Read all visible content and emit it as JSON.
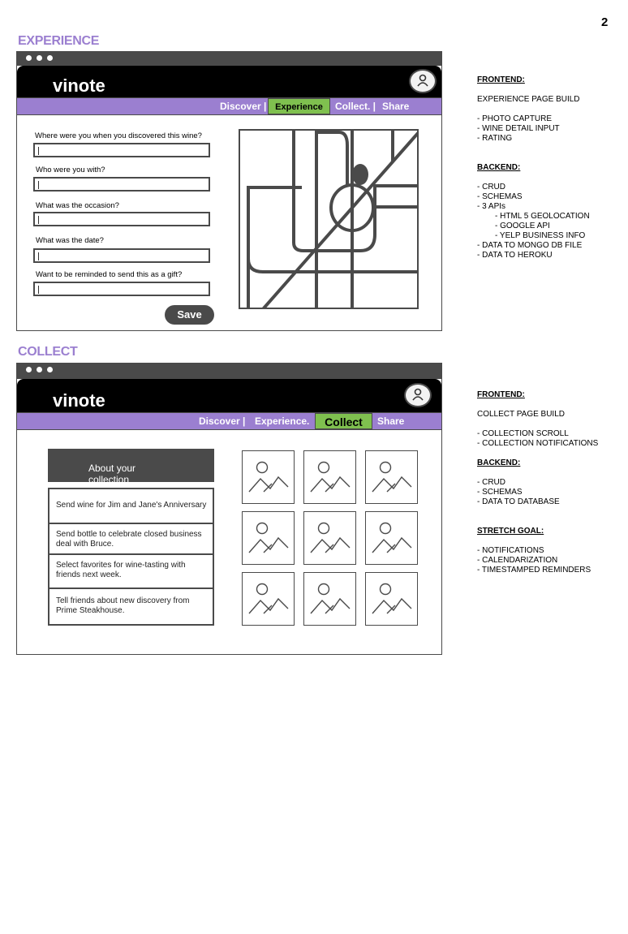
{
  "page_number": "2",
  "experience": {
    "section_title": "EXPERIENCE",
    "logo": "vinote",
    "nav": {
      "discover": "Discover |",
      "experience": "Experience",
      "collect": "Collect. |",
      "share": "Share"
    },
    "questions": [
      "Where were you when you discovered this wine?",
      "Who were you with?",
      "What was the occasion?",
      "What was the date?",
      "Want to be reminded to send this as a gift?"
    ],
    "save_label": "Save",
    "notes": {
      "frontend_heading": "FRONTEND:",
      "frontend_title": "EXPERIENCE PAGE BUILD",
      "frontend_items": [
        "- PHOTO CAPTURE",
        "- WINE DETAIL INPUT",
        "- RATING"
      ],
      "backend_heading": "BACKEND:",
      "backend_items": [
        "- CRUD",
        "- SCHEMAS",
        "- 3 APIs"
      ],
      "api_items": [
        "- HTML 5 GEOLOCATION",
        "- GOOGLE API",
        "- YELP BUSINESS INFO"
      ],
      "backend_items_2": [
        "- DATA TO MONGO DB FILE",
        "- DATA TO HEROKU"
      ]
    }
  },
  "collect": {
    "section_title": "COLLECT",
    "logo": "vinote",
    "nav": {
      "discover": "Discover |",
      "experience": "Experience.",
      "collect": "Collect",
      "share": "Share"
    },
    "about_header": "About your collection",
    "tasks": [
      "Send wine for Jim and Jane's Anniversary",
      "Send bottle to celebrate closed business deal with Bruce.",
      "Select favorites for wine-tasting with friends next week.",
      "Tell friends about new discovery from Prime Steakhouse."
    ],
    "notes": {
      "frontend_heading": "FRONTEND:",
      "frontend_title": "COLLECT PAGE BUILD",
      "frontend_items": [
        "- COLLECTION SCROLL",
        "- COLLECTION NOTIFICATIONS"
      ],
      "backend_heading": "BACKEND:",
      "backend_items": [
        "- CRUD",
        "- SCHEMAS",
        "- DATA TO DATABASE"
      ],
      "stretch_heading": "STRETCH GOAL:",
      "stretch_items": [
        "- NOTIFICATIONS",
        "- CALENDARIZATION",
        "- TIMESTAMPED REMINDERS"
      ]
    }
  },
  "colors": {
    "purple": "#9b7fd0",
    "green": "#7fc04f",
    "dark_gray": "#4a4a4a",
    "black": "#000000"
  },
  "icons": [
    "user-icon",
    "map-icon",
    "image-placeholder-icon"
  ]
}
